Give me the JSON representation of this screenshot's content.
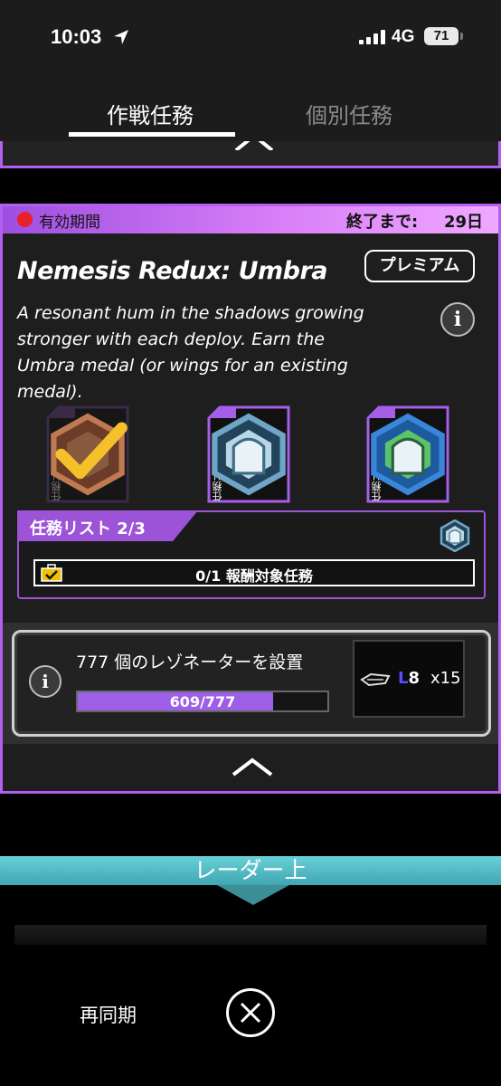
{
  "status_bar": {
    "time": "10:03",
    "network": "4G",
    "battery": "71"
  },
  "tabs": [
    {
      "label": "作戦任務",
      "active": true
    },
    {
      "label": "個別任務",
      "active": false
    }
  ],
  "mission": {
    "active_label": "有効期間",
    "end_label": "終了まで:",
    "days_left": "29日",
    "title": "Nemesis Redux: Umbra",
    "premium_label": "プレミアム",
    "description": "A resonant hum in the shadows growing stronger with each deploy. Earn the Umbra medal (or wings for an existing medal).",
    "lists": [
      {
        "number": "01",
        "caption": "任務リスト",
        "completed": true
      },
      {
        "number": "02",
        "caption": "任務リスト",
        "completed": false
      },
      {
        "number": "03",
        "caption": "任務リスト",
        "completed": false
      }
    ],
    "list_progress_label": "任務リスト 2/3",
    "rewards_label": "0/1 報酬対象任務",
    "task": {
      "label": "777 個のレゾネーターを設置",
      "progress_text": "609/777",
      "progress": 0.784,
      "reward_level_prefix": "L",
      "reward_level": "8",
      "reward_qty": "x15"
    }
  },
  "radar": {
    "label": "レーダー上"
  },
  "bottom": {
    "resync_label": "再同期"
  },
  "colors": {
    "accent": "#b160ef",
    "progress": "#9d5fe8",
    "radar": "#4fb8c2",
    "active_dot": "#e8202a"
  }
}
